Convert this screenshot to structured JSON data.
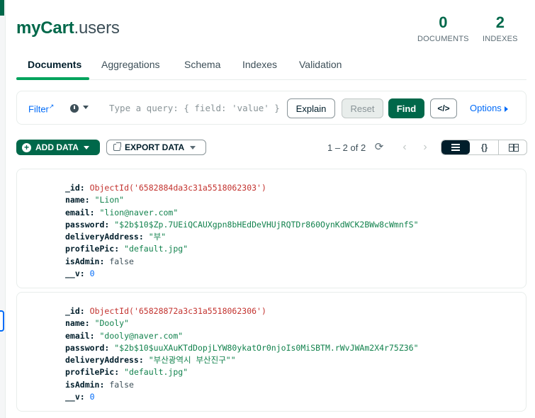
{
  "header": {
    "db_name": "myCart",
    "collection_name": ".users",
    "stats": [
      {
        "value": "0",
        "label": "DOCUMENTS"
      },
      {
        "value": "2",
        "label": "INDEXES"
      }
    ]
  },
  "tabs": [
    {
      "label": "Documents",
      "active": true
    },
    {
      "label": "Aggregations",
      "active": false
    },
    {
      "label": "Schema",
      "active": false
    },
    {
      "label": "Indexes",
      "active": false
    },
    {
      "label": "Validation",
      "active": false
    }
  ],
  "query_bar": {
    "filter_label": "Filter",
    "placeholder": "Type a query: { field: 'value' }",
    "explain_label": "Explain",
    "reset_label": "Reset",
    "find_label": "Find",
    "code_label": "</>",
    "options_label": "Options"
  },
  "toolbar": {
    "add_data_label": "ADD DATA",
    "export_data_label": "EXPORT DATA",
    "pagination_text": "1 – 2 of 2"
  },
  "documents": [
    {
      "id_label": "_id:",
      "id_value": "ObjectId('6582884da3c31a5518062303')",
      "name_label": "name:",
      "name_value": "\"Lion\"",
      "email_label": "email:",
      "email_value": "\"lion@naver.com\"",
      "password_label": "password:",
      "password_value": "\"$2b$10$Zp.7UEiQCAUXgpn8bHEdDeVHUjRQTDr860OynKdWCK2BWw8cWmnfS\"",
      "address_label": "deliveryAddress:",
      "address_value": "\"부\"",
      "pic_label": "profilePic:",
      "pic_value": "\"default.jpg\"",
      "admin_label": "isAdmin:",
      "admin_value": "false",
      "v_label": "__v:",
      "v_value": "0"
    },
    {
      "id_label": "_id:",
      "id_value": "ObjectId('65828872a3c31a5518062306')",
      "name_label": "name:",
      "name_value": "\"Dooly\"",
      "email_label": "email:",
      "email_value": "\"dooly@naver.com\"",
      "password_label": "password:",
      "password_value": "\"$2b$10$uuXAuKTdDopjLYW80ykatOr0njoIs0MiSBTM.rWvJWAm2X4r75Z36\"",
      "address_label": "deliveryAddress:",
      "address_value": "\"부산광역시 부산진구\"\"",
      "pic_label": "profilePic:",
      "pic_value": "\"default.jpg\"",
      "admin_label": "isAdmin:",
      "admin_value": "false",
      "v_label": "__v:",
      "v_value": "0"
    }
  ]
}
